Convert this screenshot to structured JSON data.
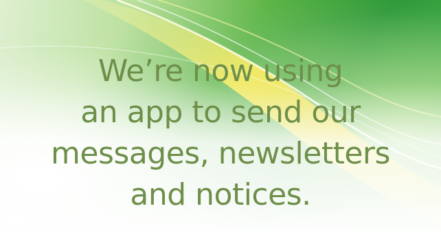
{
  "banner": {
    "lines": [
      "We’re now using",
      "an app to send our",
      "messages, newsletters",
      "and notices."
    ]
  },
  "colors": {
    "text": "#6e8f4a",
    "green_dark": "#2f9a3a",
    "green_light": "#8fd06a",
    "yellow": "#f2e23a",
    "background": "#ffffff"
  }
}
